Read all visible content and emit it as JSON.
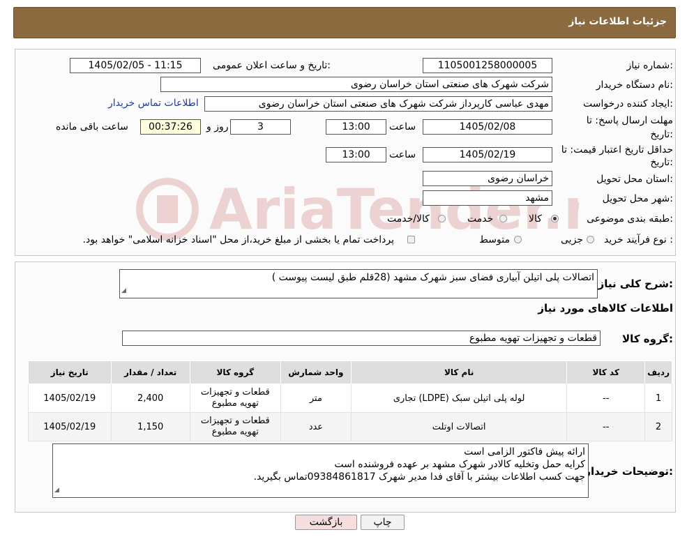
{
  "header": {
    "title": "جزئیات اطلاعات نیاز"
  },
  "info": {
    "need_number_label": "شماره نیاز:",
    "need_number": "1105001258000005",
    "announce_label": "تاریخ و ساعت اعلان عمومی:",
    "announce_value": "1405/02/05 - 11:15",
    "buyer_label": "نام دستگاه خریدار:",
    "buyer_value": "شرکت شهرک های صنعتی استان خراسان رضوی",
    "creator_label": "ایجاد کننده درخواست:",
    "creator_value": "مهدی عباسی کارپرداز شرکت شهرک های صنعتی استان خراسان رضوی",
    "contact_link": "اطلاعات تماس خریدار",
    "deadline_label_1": "مهلت ارسال پاسخ: تا",
    "deadline_label_2": "تاریخ:",
    "deadline_date": "1405/02/08",
    "hour_label": "ساعت",
    "deadline_time": "13:00",
    "days_value": "3",
    "days_label": "روز و",
    "remaining_time": "00:37:26",
    "remaining_label": "ساعت باقی مانده",
    "min_validity_label_1": "حداقل تاریخ اعتبار قیمت: تا",
    "min_validity_label_2": "تاریخ:",
    "min_validity_date": "1405/02/19",
    "min_validity_time": "13:00",
    "province_label": "استان محل تحویل:",
    "province_value": "خراسان رضوی",
    "city_label": "شهر محل تحویل:",
    "city_value": "مشهد",
    "category_label": "طبقه بندی موضوعی:",
    "category_options": [
      "کالا",
      "خدمت",
      "کالا/خدمت"
    ],
    "category_selected": "کالا",
    "purchase_label": "نوع فرآیند خرید :",
    "purchase_options": [
      "جزیی",
      "متوسط"
    ],
    "purchase_note": "پرداخت تمام یا بخشی از مبلغ خرید،از محل \"اسناد خزانه اسلامی\" خواهد بود."
  },
  "description": {
    "label": "شرح کلی نیاز:",
    "value": "اتصالات پلی اتیلن  آبیاری فضای سبز شهرک مشهد (28قلم طبق لیست پیوست )"
  },
  "goods_section_title": "اطلاعات کالاهای مورد نیاز",
  "goods_group": {
    "label": "گروه کالا:",
    "value": "قطعات و تجهیزات تهویه مطبوع"
  },
  "table": {
    "headers": [
      "ردیف",
      "کد کالا",
      "نام کالا",
      "واحد شمارش",
      "گروه کالا",
      "تعداد / مقدار",
      "تاریخ نیاز"
    ],
    "rows": [
      {
        "row": "1",
        "code": "--",
        "name": "لوله پلی اتیلن سبک (LDPE) تجاری",
        "unit": "متر",
        "group_line1": "قطعات و تجهیزات",
        "group_line2": "تهویه مطبوع",
        "qty": "2,400",
        "date": "1405/02/19"
      },
      {
        "row": "2",
        "code": "--",
        "name": "اتصالات اوتلت",
        "unit": "عدد",
        "group_line1": "قطعات و تجهیزات",
        "group_line2": "تهویه مطبوع",
        "qty": "1,150",
        "date": "1405/02/19"
      }
    ]
  },
  "buyer_notes": {
    "label": "توضیحات خریدار:",
    "lines": [
      "ارائه پیش فاکتور الزامی است",
      "کرایه حمل وتخلیه کالادر شهرک مشهد بر عهده فروشنده است",
      "جهت کسب اطلاعات بیشتر با آقای فدا مدیر شهرک 09384861817تماس بگیرید."
    ]
  },
  "buttons": {
    "print": "چاپ",
    "back": "بازگشت"
  },
  "watermark_text": "AriaTender.neT",
  "colors": {
    "header_bg": "#8b6a3f",
    "link": "#1a3da8",
    "timer_bg": "#ffffde",
    "back_btn": "#f6dede"
  }
}
